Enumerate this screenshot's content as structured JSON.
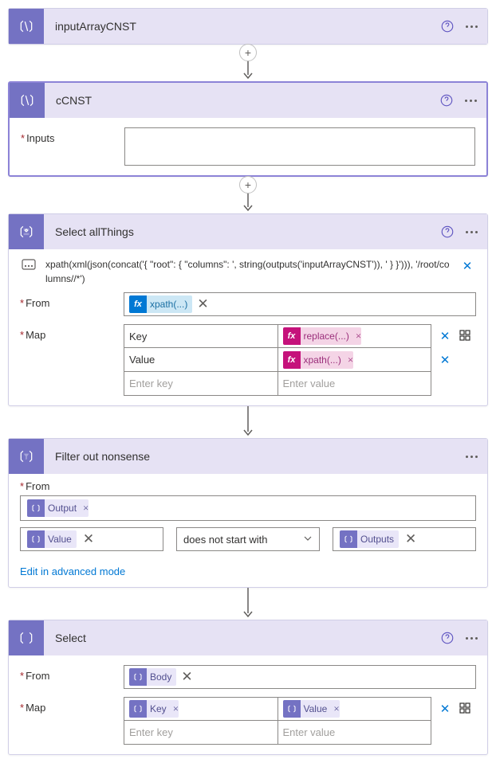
{
  "card1": {
    "title": "inputArrayCNST"
  },
  "card2": {
    "title": "cCNST",
    "inputsLabel": "Inputs"
  },
  "card3": {
    "title": "Select allThings",
    "xpathText": "xpath(xml(json(concat('{ \"root\": { \"columns\": ', string(outputs('inputArrayCNST')), ' } }'))), '/root/columns//*')",
    "fromLabel": "From",
    "mapLabel": "Map",
    "fromToken": "xpath(...)",
    "mapRows": [
      {
        "key": "Key",
        "valToken": "replace(...)"
      },
      {
        "key": "Value",
        "valToken": "xpath(...)"
      }
    ],
    "keyPlaceholder": "Enter key",
    "valPlaceholder": "Enter value"
  },
  "card4": {
    "title": "Filter out nonsense",
    "fromLabel": "From",
    "fromToken": "Output",
    "leftToken": "Value",
    "op": "does not start with",
    "rightToken": "Outputs",
    "advLink": "Edit in advanced mode"
  },
  "card5": {
    "title": "Select",
    "fromLabel": "From",
    "mapLabel": "Map",
    "fromToken": "Body",
    "keyToken": "Key",
    "valToken": "Value",
    "keyPlaceholder": "Enter key",
    "valPlaceholder": "Enter value"
  }
}
